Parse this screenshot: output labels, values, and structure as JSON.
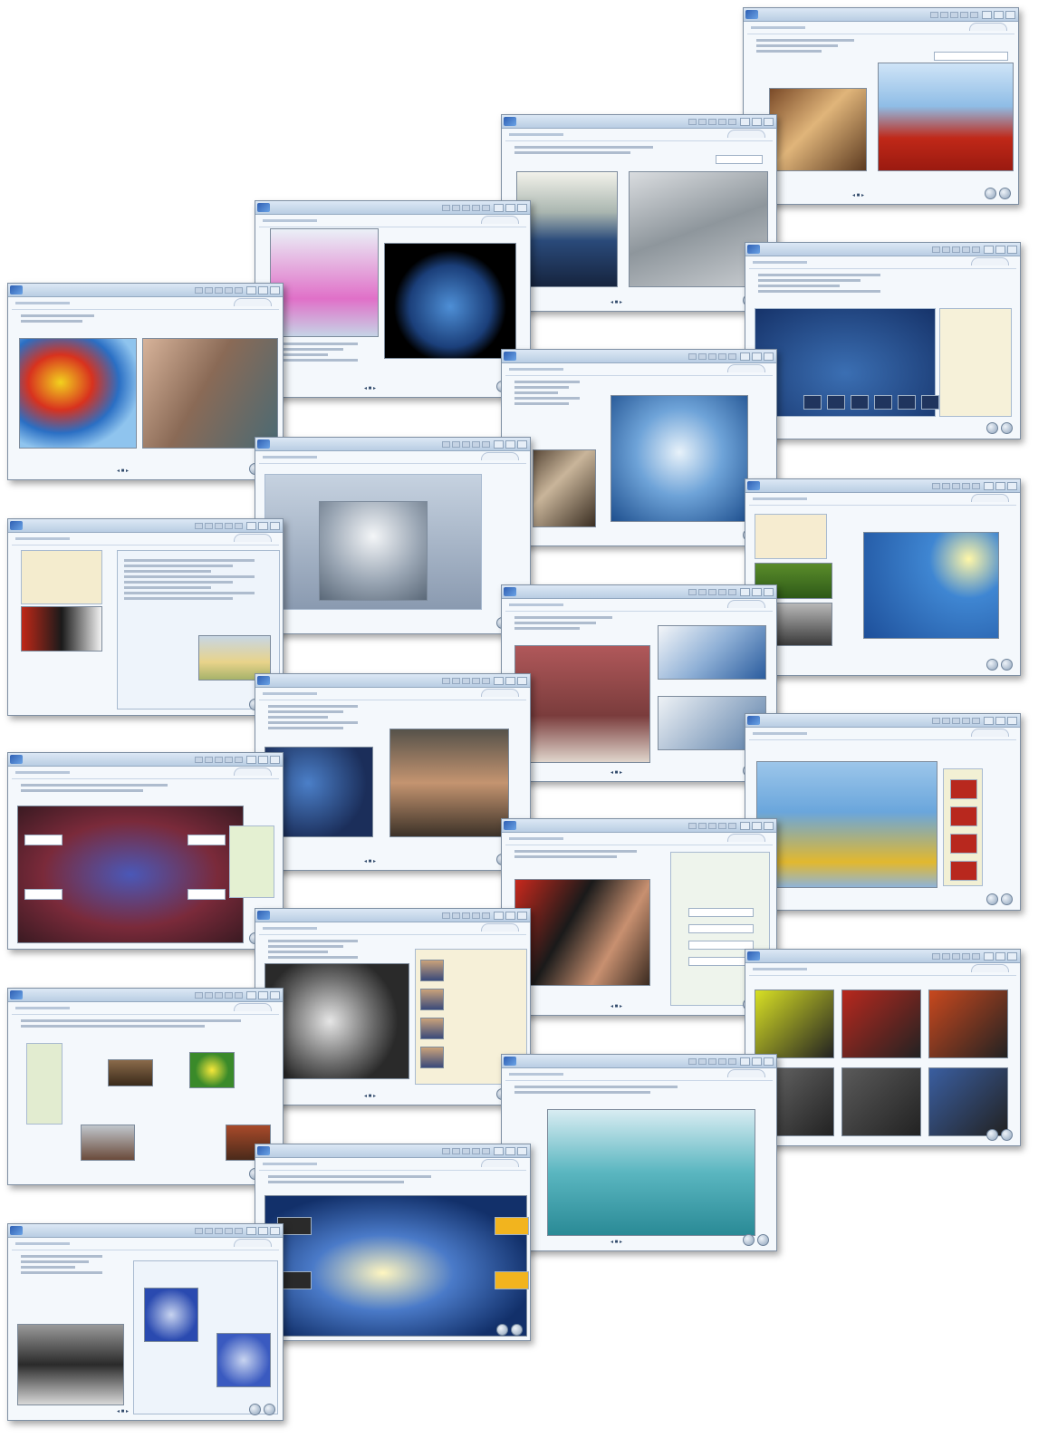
{
  "collage": {
    "windows": [
      {
        "title": "",
        "pager": "◂ ■ ▸",
        "scene": "portrait"
      },
      {
        "title": "",
        "pager": "◂ ■ ▸",
        "scene": "lab"
      },
      {
        "title": "",
        "pager": "",
        "scene": "motor"
      },
      {
        "title": "",
        "pager": "◂ ■ ▸",
        "scene": "earth"
      },
      {
        "title": "",
        "pager": "",
        "scene": "diamond"
      },
      {
        "title": "",
        "pager": "◂ ■ ▸",
        "scene": "balloon"
      },
      {
        "title": "",
        "pager": "",
        "scene": "globe-sun"
      },
      {
        "title": "",
        "pager": "",
        "scene": "apparatus"
      },
      {
        "title": "",
        "pager": "",
        "scene": "form"
      },
      {
        "title": "",
        "pager": "◂ ■ ▸",
        "scene": "glass"
      },
      {
        "title": "",
        "pager": "",
        "scene": "blocks"
      },
      {
        "title": "",
        "pager": "◂ ■ ▸",
        "scene": "eating"
      },
      {
        "title": "",
        "pager": "",
        "scene": "bubble"
      },
      {
        "title": "",
        "pager": "◂ ■ ▸",
        "scene": "phone"
      },
      {
        "title": "",
        "pager": "",
        "scene": "photos"
      },
      {
        "title": "",
        "pager": "◂ ■ ▸",
        "scene": "gears"
      },
      {
        "title": "",
        "pager": "",
        "scene": "cycle"
      },
      {
        "title": "",
        "pager": "◂ ■ ▸",
        "scene": "beakers"
      },
      {
        "title": "",
        "pager": "",
        "scene": "energy"
      },
      {
        "title": "",
        "pager": "◂ ■ ▸",
        "scene": "cells"
      }
    ]
  },
  "colors": {
    "titlebar": "#c9d9ec",
    "accent": "#2f5fb3",
    "frame": "#7e8fa3"
  }
}
